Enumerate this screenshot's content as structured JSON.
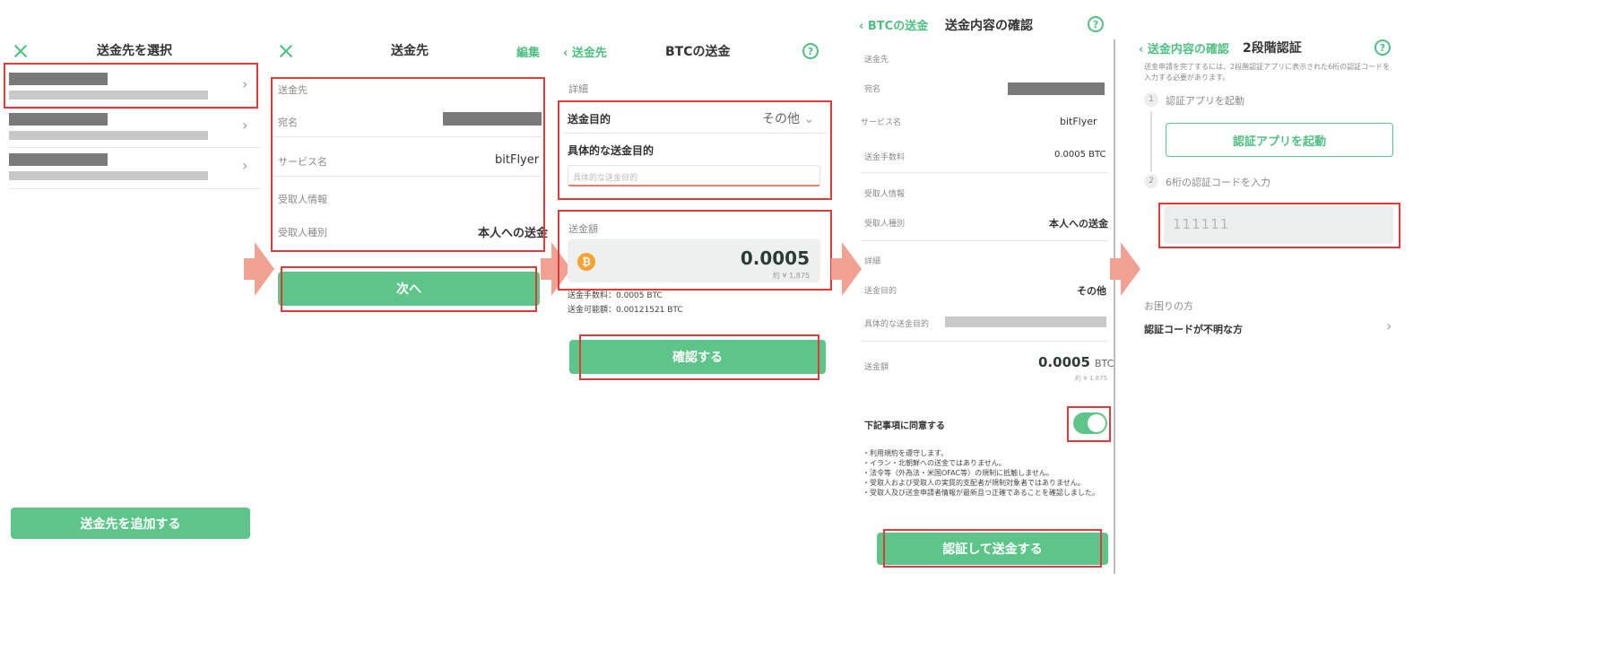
{
  "s1": {
    "title": "送金先を選択",
    "add_button": "送金先を追加する"
  },
  "s2": {
    "title": "送金先",
    "edit": "編集",
    "section_recipient": "送金先",
    "name_label": "宛名",
    "service_label": "サービス名",
    "service_value": "bitFlyer",
    "receiver_info": "受取人情報",
    "receiver_type_label": "受取人種別",
    "receiver_type_value": "本人への送金",
    "next_button": "次へ"
  },
  "s3": {
    "back": "送金先",
    "title": "BTCの送金",
    "detail": "詳細",
    "purpose_label": "送金目的",
    "purpose_value": "その他",
    "specific_purpose_label": "具体的な送金目的",
    "specific_purpose_placeholder": "具体的な送金目的",
    "amount_label": "送金額",
    "amount_value": "0.0005",
    "amount_yen": "約 ¥ 1,875",
    "fee_line": "送金手数料：0.0005 BTC",
    "available_line": "送金可能額：0.00121521 BTC",
    "confirm_button": "確認する"
  },
  "s4": {
    "back": "BTCの送金",
    "title": "送金内容の確認",
    "recipient": "送金先",
    "name_label": "宛名",
    "service_label": "サービス名",
    "service_value": "bitFlyer",
    "fee_label": "送金手数料",
    "fee_value": "0.0005 BTC",
    "receiver_info": "受取人情報",
    "receiver_type_label": "受取人種別",
    "receiver_type_value": "本人への送金",
    "detail": "詳細",
    "purpose_label": "送金目的",
    "purpose_value": "その他",
    "specific_label": "具体的な送金目的",
    "amount_label": "送金額",
    "amount_value": "0.0005",
    "amount_unit": "BTC",
    "amount_yen": "約 ¥ 1,875",
    "agree_label": "下記事項に同意する",
    "agree_on": true,
    "terms": [
      "・利用規約を遵守します。",
      "・イラン・北朝鮮への送金ではありません。",
      "・法令等（外為法・米国OFAC等）の規制に抵触しません。",
      "・受取人および受取人の実質的支配者が規制対象者ではありません。",
      "・受取人及び送金申請者情報が最新且つ正確であることを確認しました。"
    ],
    "send_button": "認証して送金する"
  },
  "s5": {
    "back": "送金内容の確認",
    "title": "2段階認証",
    "description": "送金申請を完了するには、2段階認証アプリに表示された6桁の認証コードを入力する必要があります。",
    "step1_num": "1",
    "step1_label": "認証アプリを起動",
    "launch_button": "認証アプリを起動",
    "step2_num": "2",
    "step2_label": "6桁の認証コードを入力",
    "code_placeholder": "111111",
    "help_heading": "お困りの方",
    "help_link": "認証コードが不明な方"
  },
  "colors": {
    "accent": "#5ec58a",
    "highlight": "#e03a3a",
    "arrow": "#f1a192"
  }
}
